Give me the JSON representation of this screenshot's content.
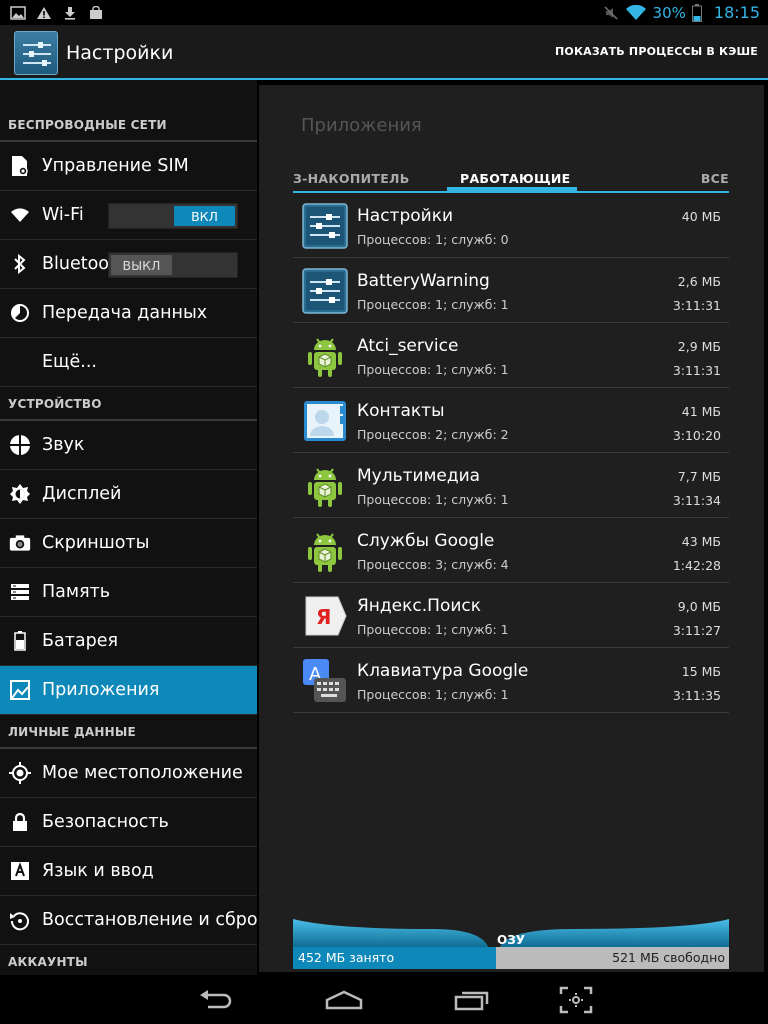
{
  "status": {
    "battery": "30%",
    "time": "18:15"
  },
  "actionbar": {
    "title": "Настройки",
    "action": "ПОКАЗАТЬ ПРОЦЕССЫ В КЭШЕ"
  },
  "sidebar": {
    "sections": [
      {
        "header": "БЕСПРОВОДНЫЕ СЕТИ"
      },
      {
        "header": "УСТРОЙСТВО"
      },
      {
        "header": "ЛИЧНЫЕ ДАННЫЕ"
      },
      {
        "header": "АККАУНТЫ"
      }
    ],
    "items": {
      "sim": "Управление SIM",
      "wifi": "Wi-Fi",
      "wifi_toggle": "ВКЛ",
      "bluetooth": "Bluetooth",
      "bluetooth_toggle": "ВЫКЛ",
      "data": "Передача данных",
      "more": "Ещё...",
      "sound": "Звук",
      "display": "Дисплей",
      "screenshots": "Скриншоты",
      "memory": "Память",
      "battery": "Батарея",
      "apps": "Приложения",
      "location": "Мое местоположение",
      "security": "Безопасность",
      "language": "Язык и ввод",
      "backup": "Восстановление и сброс"
    }
  },
  "main": {
    "title": "Приложения",
    "tabs": {
      "left": "З-НАКОПИТЕЛЬ",
      "active": "РАБОТАЮЩИЕ",
      "right": "ВСЕ"
    },
    "apps": [
      {
        "name": "Настройки",
        "sub": "Процессов: 1; служб: 0",
        "size": "40 МБ",
        "time": "",
        "icon": "settings-icon"
      },
      {
        "name": "BatteryWarning",
        "sub": "Процессов: 1; служб: 1",
        "size": "2,6 МБ",
        "time": "3:11:31",
        "icon": "settings-icon"
      },
      {
        "name": "Atci_service",
        "sub": "Процессов: 1; служб: 1",
        "size": "2,9 МБ",
        "time": "3:11:31",
        "icon": "android-icon"
      },
      {
        "name": "Контакты",
        "sub": "Процессов: 2; служб: 2",
        "size": "41 МБ",
        "time": "3:10:20",
        "icon": "contacts-icon"
      },
      {
        "name": "Мультимедиа",
        "sub": "Процессов: 1; служб: 1",
        "size": "7,7 МБ",
        "time": "3:11:34",
        "icon": "android-icon"
      },
      {
        "name": "Службы Google",
        "sub": "Процессов: 3; служб: 4",
        "size": "43 МБ",
        "time": "1:42:28",
        "icon": "android-icon"
      },
      {
        "name": "Яндекс.Поиск",
        "sub": "Процессов: 1; служб: 1",
        "size": "9,0 МБ",
        "time": "3:11:27",
        "icon": "yandex-icon"
      },
      {
        "name": "Клавиатура Google",
        "sub": "Процессов: 1; служб: 1",
        "size": "15 МБ",
        "time": "3:11:35",
        "icon": "keyboard-icon"
      }
    ],
    "ram": {
      "label": "ОЗУ",
      "used": "452 МБ занято",
      "free": "521 МБ свободно",
      "used_fraction": 0.465
    }
  },
  "colors": {
    "accent": "#33b5e5",
    "active": "#0e88b8"
  }
}
